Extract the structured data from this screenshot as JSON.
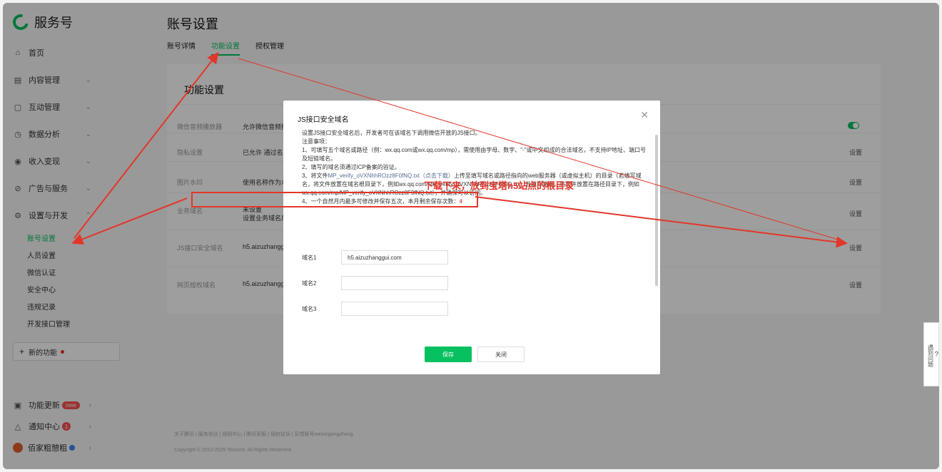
{
  "sidebar": {
    "brand": "服务号",
    "items": [
      {
        "icon": "⌂",
        "label": "首页"
      },
      {
        "icon": "▤",
        "label": "内容管理"
      },
      {
        "icon": "▢",
        "label": "互动管理"
      },
      {
        "icon": "◷",
        "label": "数据分析"
      },
      {
        "icon": "◉",
        "label": "收入变现"
      },
      {
        "icon": "⊘",
        "label": "广告与服务"
      },
      {
        "icon": "⚙",
        "label": "设置与开发"
      }
    ],
    "sub_items": [
      "账号设置",
      "人员设置",
      "微信认证",
      "安全中心",
      "违规记录",
      "开发接口管理"
    ],
    "new_function": "新的功能",
    "bottom": {
      "update_label": "功能更新",
      "update_badge": "new",
      "notify_label": "通知中心",
      "notify_count": "1",
      "account_name": "佰家粗憩粗"
    }
  },
  "header": {
    "title": "账号设置",
    "tabs": [
      "账号详情",
      "功能设置",
      "授权管理"
    ]
  },
  "panel": {
    "title": "功能设置",
    "rows": [
      {
        "label": "微信音频播放器",
        "value": "允许微信音频播"
      },
      {
        "label": "隐私设置",
        "value": "已允许 通过名称",
        "action": "设置"
      },
      {
        "label": "图片水印",
        "value": "使用名称作为水",
        "action": "设置"
      },
      {
        "label": "业务域名",
        "value": "未设置",
        "value2": "设置业务域名后",
        "action": "设置"
      },
      {
        "label": "JS接口安全域名",
        "value": "h5.aizuzhangg",
        "action": "设置"
      },
      {
        "label": "网页授权域名",
        "value": "h5.aizuzhangg",
        "action": "设置"
      }
    ]
  },
  "footer": {
    "links": "关于腾讯 | 服务协议 | 规则中心 | 腾讯客服 | 侵权投诉 | 反馈账号weixingongzhong",
    "copyright": "Copyright © 2012-2025 Tencent. All Rights Reserved."
  },
  "modal": {
    "title": "JS接口安全域名",
    "close": "✕",
    "intro": "设置JS接口安全域名后，开发者可在该域名下调用微信开放的JS接口。",
    "notes_title": "注意事项：",
    "note1": "1、可填写五个域名或路径（例：wx.qq.com或wx.qq.com/mp），需使用由字母、数字、\"-\"或中文组成的合法域名，不支持IP地址、端口号及短链域名。",
    "note2": "2、填写的域名须通过ICP备案的验证。",
    "note3_prefix": "3、将文件",
    "note3_file": "MP_verify_oVXNhhROzz8F0fNQ.txt（点击下载）",
    "note3_suffix": "上传至填写域名或路径指向的web服务器（或虚拟主机）的目录（若填写域名，将文件放置在域名根目录下，例如wx.qq.com/MP_verify_oVXNhhROzz8F0fNQ.txt；若填写路径，将文件放置在路径目录下，例如wx.qq.com/mp/MP_verify_oVXNhhROzz8F0fNQ.txt），并确保可以访问。",
    "note4_prefix": "4、一个自然月内最多可修改并保存五次，本月剩余保存次数：",
    "note4_count": "4",
    "fields": [
      {
        "label": "域名1",
        "value": "h5.aizuzhanggui.com"
      },
      {
        "label": "域名2",
        "value": ""
      },
      {
        "label": "域名3",
        "value": ""
      }
    ],
    "save": "保存",
    "cancel": "关闭"
  },
  "annotation": "下载下来，放到宝塔h5站点的根目录",
  "help_tab": "遇到问题",
  "colors": {
    "accent": "#07c160",
    "annotation": "#e3362a",
    "badge": "#fa5151"
  }
}
